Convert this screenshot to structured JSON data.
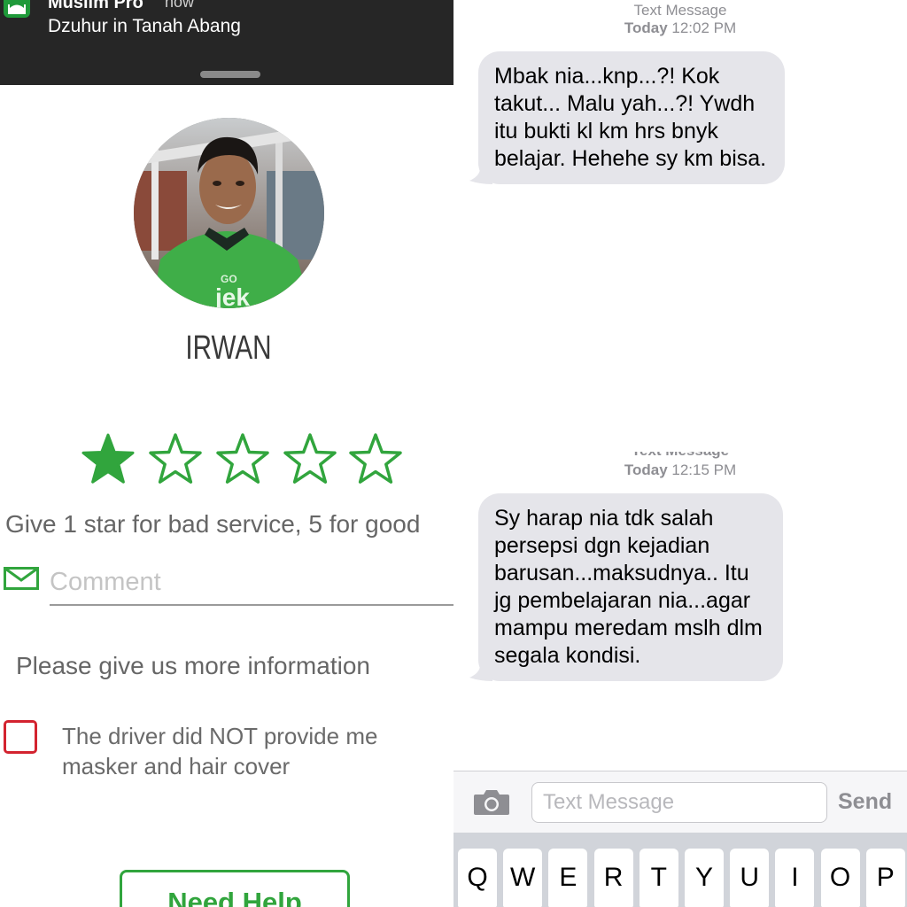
{
  "notification": {
    "app_name": "Muslim Pro",
    "time": "now",
    "body": "Dzuhur in Tanah Abang"
  },
  "driver": {
    "name": "IRWAN"
  },
  "rating": {
    "selected_stars": 1,
    "max_stars": 5,
    "hint": "Give 1 star for bad service, 5 for good",
    "accent_color": "#31a53d"
  },
  "comment": {
    "placeholder": "Comment"
  },
  "feedback": {
    "prompt": "Please give us more information",
    "options": [
      {
        "label": "The driver did NOT provide me masker and hair cover",
        "checked": false
      }
    ]
  },
  "help_button": {
    "label": "Need Help"
  },
  "messages": [
    {
      "header": "Text Message",
      "day": "Today",
      "time": "12:02 PM",
      "text": "Mbak nia...knp...?! Kok takut... Malu yah...?! Ywdh itu bukti kl km hrs bnyk belajar. Hehehe sy km bisa."
    },
    {
      "header": "Text Message",
      "day": "Today",
      "time": "12:15 PM",
      "text": "Sy harap nia tdk salah persepsi dgn kejadian barusan...maksudnya.. Itu jg pembelajaran nia...agar mampu meredam mslh dlm segala kondisi."
    }
  ],
  "composer": {
    "placeholder": "Text Message",
    "send_label": "Send"
  },
  "keyboard": {
    "row1": [
      "Q",
      "W",
      "E",
      "R",
      "T",
      "Y",
      "U",
      "I",
      "O",
      "P"
    ]
  },
  "colors": {
    "bubble": "#e5e5ea",
    "checkbox_border": "#d3232f",
    "notification_bg": "#262626"
  }
}
